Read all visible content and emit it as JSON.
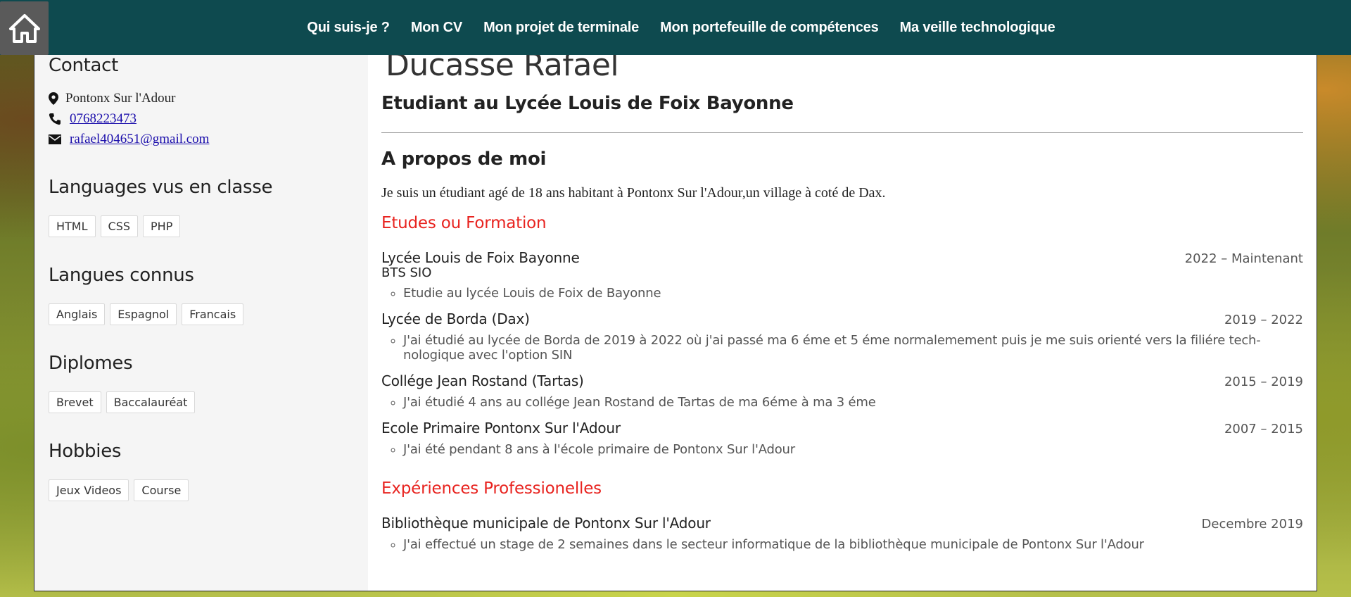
{
  "nav": {
    "home_icon": "home-icon",
    "links": [
      "Qui suis-je ?",
      "Mon CV",
      "Mon projet de terminale",
      "Mon portefeuille de compétences",
      "Ma veille technologique"
    ]
  },
  "sidebar": {
    "contact_title": "Contact",
    "location": "Pontonx Sur l'Adour",
    "phone": "0768223473",
    "email": "rafael404651@gmail.com",
    "languages_title": "Languages vus en classe",
    "languages": [
      "HTML",
      "CSS",
      "PHP"
    ],
    "langues_title": "Langues connus",
    "langues": [
      "Anglais",
      "Espagnol",
      "Francais"
    ],
    "diplomes_title": "Diplomes",
    "diplomes": [
      "Brevet",
      "Baccalauréat"
    ],
    "hobbies_title": "Hobbies",
    "hobbies": [
      "Jeux Videos",
      "Course"
    ]
  },
  "main": {
    "name": "Ducasse Rafael",
    "subtitle": "Etudiant au Lycée Louis de Foix Bayonne",
    "about_title": "A propos de moi",
    "about_text": "Je suis un étudiant agé de 18 ans habitant à Pontonx Sur l'Adour,un village à coté de Dax.",
    "education_title": "Etudes ou Formation",
    "education": [
      {
        "title": "Lycée Louis de Foix Bayonne",
        "date": "2022 – Maintenant",
        "sub": "BTS SIO",
        "detail": "Etudie au lycée Louis de Foix de Bayonne"
      },
      {
        "title": "Lycée de Borda (Dax)",
        "date": "2019 – 2022",
        "detail": "J'ai étudié au lycée de Borda de 2019 à 2022 où j'ai passé ma 6 éme et 5 éme normalemement puis je me suis orienté vers la filiére tech-nologique avec l'option SIN"
      },
      {
        "title": "Collége Jean Rostand (Tartas)",
        "date": "2015 – 2019",
        "detail": "J'ai étudié 4 ans au collége Jean Rostand de Tartas de ma 6éme à ma 3 éme"
      },
      {
        "title": "Ecole Primaire Pontonx Sur l'Adour",
        "date": "2007 – 2015",
        "detail": "J'ai été pendant 8 ans à l'école primaire de Pontonx Sur l'Adour"
      }
    ],
    "experience_title": "Expériences Professionelles",
    "experience": [
      {
        "title": "Bibliothèque municipale de Pontonx Sur l'Adour",
        "date": "Decembre 2019",
        "detail": "J'ai effectué un stage de 2 semaines dans le secteur informatique de la bibliothèque municipale de Pontonx Sur l'Adour"
      }
    ]
  }
}
